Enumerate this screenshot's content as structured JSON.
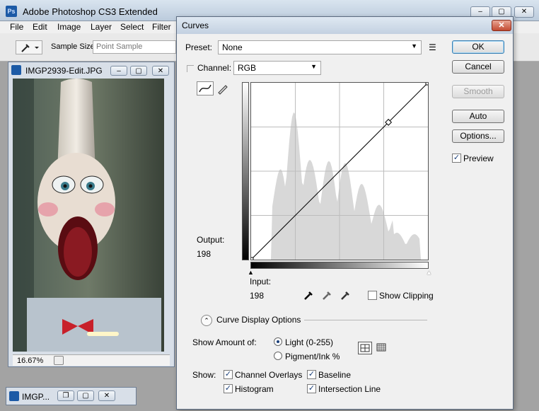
{
  "app": {
    "title": "Adobe Photoshop CS3 Extended",
    "logo_text": "Ps"
  },
  "menu": [
    "File",
    "Edit",
    "Image",
    "Layer",
    "Select",
    "Filter"
  ],
  "options_bar": {
    "sample_size_label": "Sample Size:",
    "sample_size_value": "Point Sample"
  },
  "document": {
    "title": "IMGP2939-Edit.JPG",
    "zoom": "16.67%",
    "mini_title": "IMGP..."
  },
  "curves": {
    "title": "Curves",
    "preset_label": "Preset:",
    "preset_value": "None",
    "channel_label": "Channel:",
    "channel_value": "RGB",
    "buttons": {
      "ok": "OK",
      "cancel": "Cancel",
      "smooth": "Smooth",
      "auto": "Auto",
      "options": "Options..."
    },
    "preview_label": "Preview",
    "preview_checked": true,
    "output_label": "Output:",
    "output_value": "198",
    "input_label": "Input:",
    "input_value": "198",
    "show_clipping_label": "Show Clipping",
    "curve_display_options_label": "Curve Display Options",
    "show_amount_label": "Show Amount of:",
    "light_label": "Light  (0-255)",
    "pigment_label": "Pigment/Ink %",
    "amount_selected": "light",
    "show_label": "Show:",
    "channel_overlays_label": "Channel Overlays",
    "baseline_label": "Baseline",
    "histogram_label": "Histogram",
    "intersection_line_label": "Intersection Line",
    "curve_point": {
      "input": 198,
      "output": 198
    }
  },
  "colors": {
    "accent": "#3c7fb1",
    "dialog_bg": "#f0f0f0",
    "close_red": "#c24a32"
  }
}
